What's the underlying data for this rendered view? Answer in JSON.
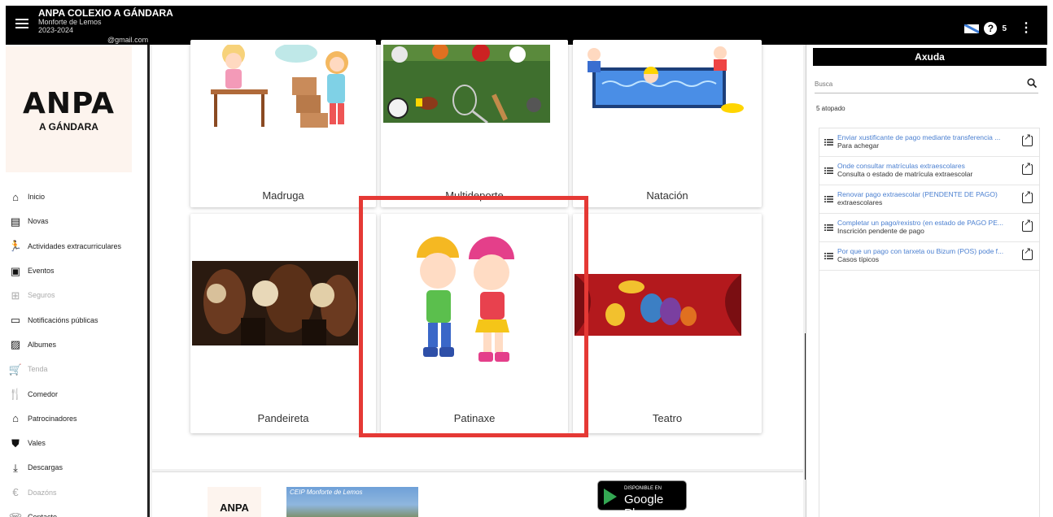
{
  "topbar": {
    "org_name": "ANPA COLEXIO A GÁNDARA",
    "city": "Monforte de Lemos",
    "year": "2023-2024",
    "email": "@gmail.com",
    "help_count": "5",
    "help_symbol": "?"
  },
  "sidebar": {
    "logo_main": "ANPA",
    "logo_sub": "A GÁNDARA",
    "items": [
      {
        "label": "Inicio",
        "icon": "home-icon",
        "enabled": true
      },
      {
        "label": "Novas",
        "icon": "news-icon",
        "enabled": true
      },
      {
        "label": "Actividades extracurriculares",
        "icon": "running-icon",
        "enabled": true
      },
      {
        "label": "Eventos",
        "icon": "calendar-icon",
        "enabled": true
      },
      {
        "label": "Seguros",
        "icon": "plus-box-icon",
        "enabled": false
      },
      {
        "label": "Notificacións públicas",
        "icon": "message-icon",
        "enabled": true
      },
      {
        "label": "Albumes",
        "icon": "image-icon",
        "enabled": true
      },
      {
        "label": "Tenda",
        "icon": "cart-icon",
        "enabled": false
      },
      {
        "label": "Comedor",
        "icon": "restaurant-icon",
        "enabled": true
      },
      {
        "label": "Patrocinadores",
        "icon": "store-icon",
        "enabled": true
      },
      {
        "label": "Vales",
        "icon": "verified-icon",
        "enabled": true
      },
      {
        "label": "Descargas",
        "icon": "download-icon",
        "enabled": true
      },
      {
        "label": "Doazóns",
        "icon": "euro-icon",
        "enabled": false
      },
      {
        "label": "Contacto",
        "icon": "contact-icon",
        "enabled": true
      }
    ]
  },
  "activities": [
    {
      "label": "Madruga"
    },
    {
      "label": "Multideporte"
    },
    {
      "label": "Natación"
    },
    {
      "label": "Pandeireta"
    },
    {
      "label": "Patinaxe"
    },
    {
      "label": "Teatro"
    }
  ],
  "footer": {
    "logo_text": "ANPA",
    "photo_caption": "CEIP Monforte de Lemos",
    "gplay_small": "DISPONIBLE EN",
    "gplay_big": "Google Play"
  },
  "help": {
    "title": "Axuda",
    "search_placeholder": "Busca",
    "found_text": "5 atopado",
    "items": [
      {
        "title": "Enviar xustificante de pago mediante transferencia ...",
        "subtitle": "Para achegar"
      },
      {
        "title": "Onde consultar matrículas extraescolares",
        "subtitle": "Consulta o estado de matrícula extraescolar"
      },
      {
        "title": "Renovar pago extraescolar (PENDENTE DE PAGO)",
        "subtitle": "extraescolares"
      },
      {
        "title": "Completar un pago/rexistro (en estado de PAGO PE...",
        "subtitle": "Inscrición pendente de pago"
      },
      {
        "title": "Por que un pago con tarxeta ou Bizum (POS) pode f...",
        "subtitle": "Casos típicos"
      }
    ]
  },
  "colors": {
    "topbar": "#000000",
    "highlight": "#e53935",
    "link": "#4a7fd0",
    "logo_bg": "#fdf4ee"
  }
}
